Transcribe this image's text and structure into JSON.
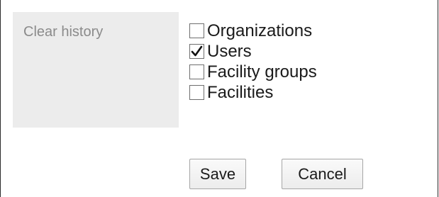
{
  "form": {
    "label": "Clear history",
    "options": [
      {
        "label": "Organizations",
        "checked": false
      },
      {
        "label": "Users",
        "checked": true
      },
      {
        "label": "Facility groups",
        "checked": false
      },
      {
        "label": "Facilities",
        "checked": false
      }
    ]
  },
  "actions": {
    "save_label": "Save",
    "cancel_label": "Cancel"
  },
  "colors": {
    "label_cell_bg": "#ececec",
    "label_text": "#8b8b8b"
  },
  "icons": {
    "checkmark": "check-icon"
  }
}
